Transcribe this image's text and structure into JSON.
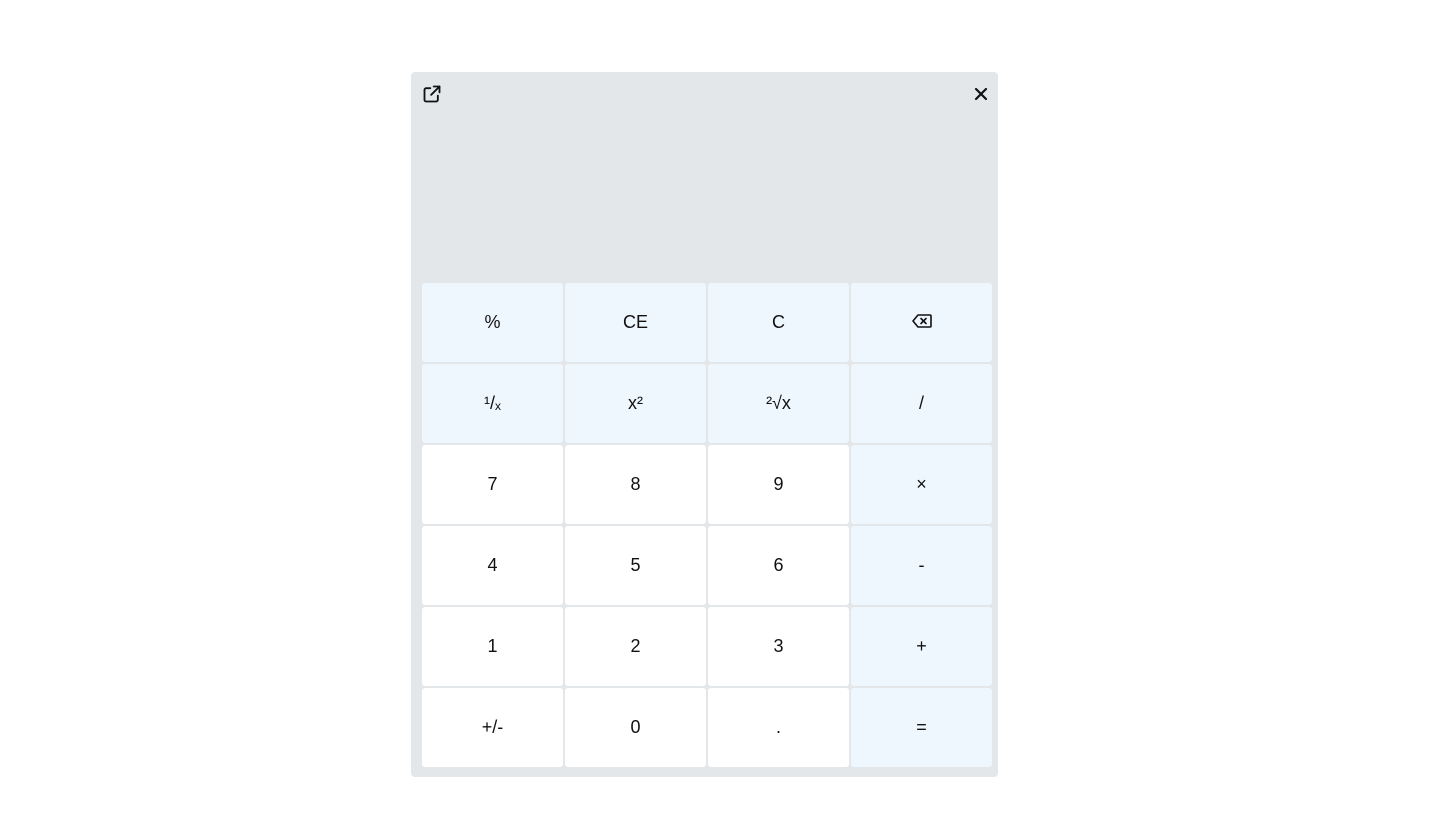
{
  "window": {
    "popout_icon": "external-link-icon",
    "close_icon": "close-icon"
  },
  "display": {
    "expression": "",
    "result": ""
  },
  "colors": {
    "window_bg": "#e4e7ea",
    "function_key_bg": "#eef6fe",
    "number_key_bg": "#ffffff"
  },
  "keys": [
    {
      "label": "%",
      "kind": "fn"
    },
    {
      "label": "CE",
      "kind": "fn"
    },
    {
      "label": "C",
      "kind": "fn"
    },
    {
      "label": "⌫",
      "kind": "fn",
      "icon": "backspace-icon"
    },
    {
      "label": "¹/ₓ",
      "kind": "fn"
    },
    {
      "label": "x²",
      "kind": "fn"
    },
    {
      "label": "²√x",
      "kind": "fn"
    },
    {
      "label": "/",
      "kind": "fn"
    },
    {
      "label": "7",
      "kind": "num"
    },
    {
      "label": "8",
      "kind": "num"
    },
    {
      "label": "9",
      "kind": "num"
    },
    {
      "label": "×",
      "kind": "fn"
    },
    {
      "label": "4",
      "kind": "num"
    },
    {
      "label": "5",
      "kind": "num"
    },
    {
      "label": "6",
      "kind": "num"
    },
    {
      "label": "-",
      "kind": "fn"
    },
    {
      "label": "1",
      "kind": "num"
    },
    {
      "label": "2",
      "kind": "num"
    },
    {
      "label": "3",
      "kind": "num"
    },
    {
      "label": "+",
      "kind": "fn"
    },
    {
      "label": "+/-",
      "kind": "num"
    },
    {
      "label": "0",
      "kind": "num"
    },
    {
      "label": ".",
      "kind": "num"
    },
    {
      "label": "=",
      "kind": "fn"
    }
  ]
}
